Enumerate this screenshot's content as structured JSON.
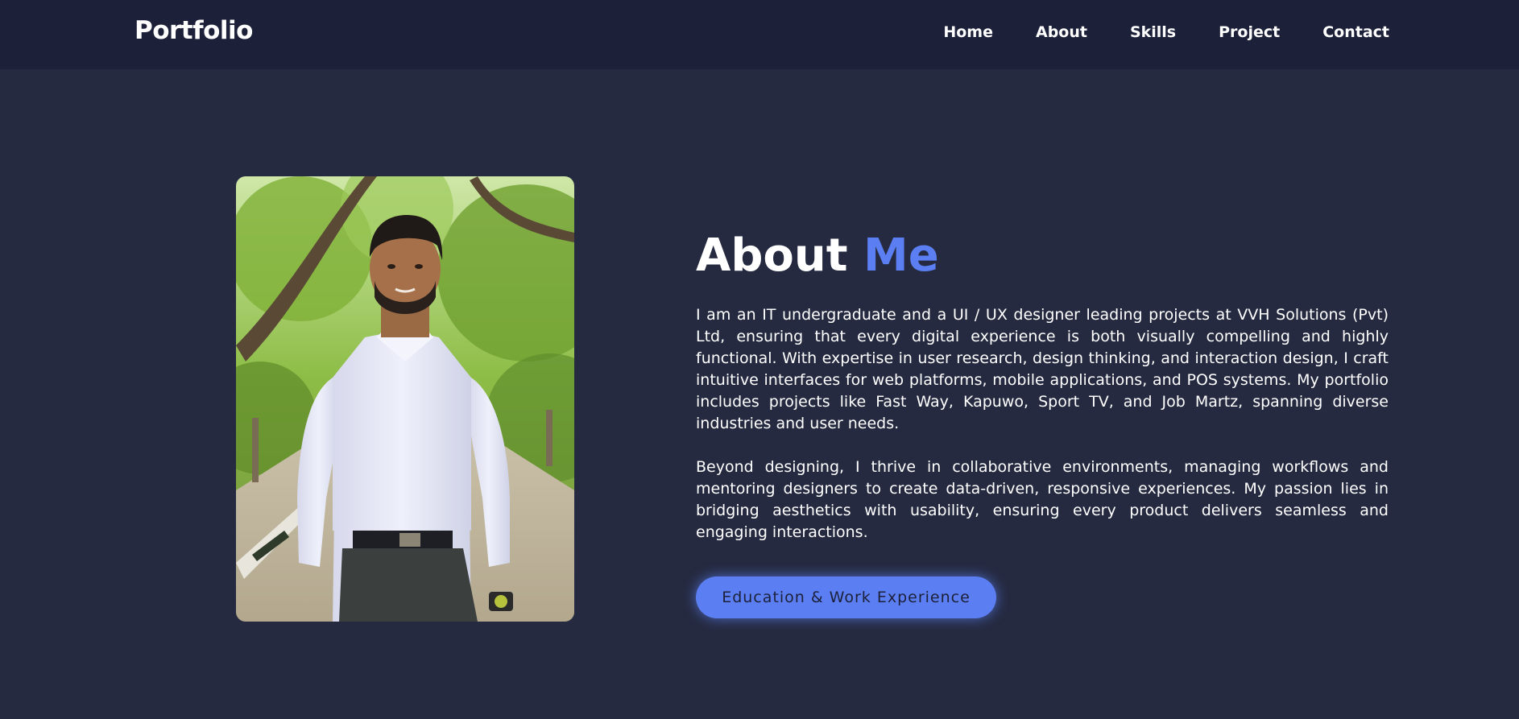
{
  "header": {
    "brand": "Portfolio",
    "nav": [
      "Home",
      "About",
      "Skills",
      "Project",
      "Contact"
    ]
  },
  "about": {
    "heading_main": "About",
    "heading_accent": "Me",
    "paragraphs": [
      "I am an IT undergraduate and a UI / UX designer leading projects at VVH Solutions (Pvt) Ltd, ensuring that every digital experience is both visually compelling and highly functional. With expertise in user research, design thinking, and interaction design, I craft intuitive interfaces for web platforms, mobile applications, and POS systems. My portfolio includes projects like Fast Way, Kapuwo, Sport TV, and Job Martz, spanning diverse industries and user needs.",
      "Beyond designing, I thrive in collaborative environments, managing workflows and mentoring designers to create data-driven, responsive experiences. My passion lies in bridging aesthetics with usability, ensuring every product delivers seamless and engaging interactions."
    ],
    "button_label": "Education & Work Experience"
  },
  "colors": {
    "page_background": "#252a40",
    "navbar_background": "#1c2039",
    "accent": "#5b7ff2",
    "text": "#ffffff"
  }
}
